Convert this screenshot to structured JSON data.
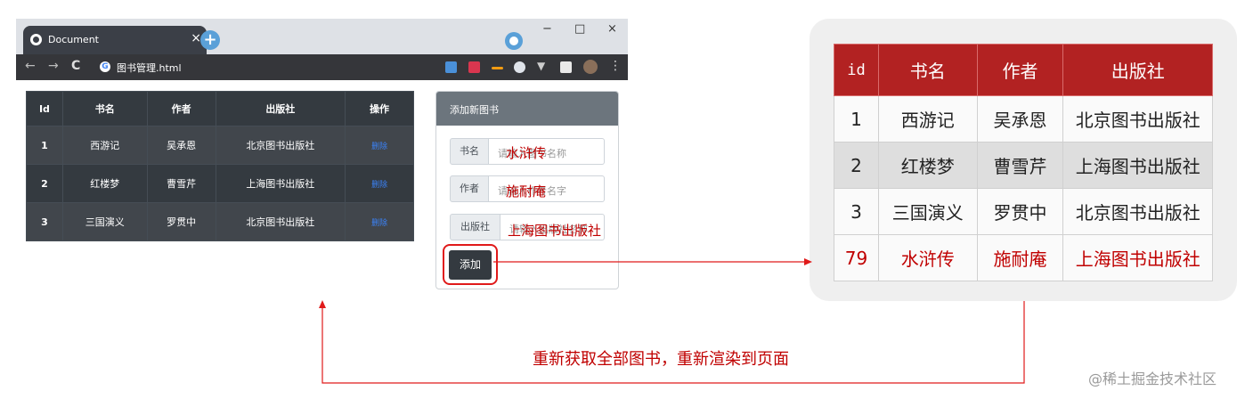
{
  "browser": {
    "tab_title": "Document",
    "tab_close": "×",
    "new_tab": "+",
    "url": "图书管理.html",
    "nav": {
      "back": "←",
      "forward": "→",
      "reload": "C"
    },
    "window": {
      "minimize": "−",
      "maximize": "□",
      "close": "×"
    },
    "menu": "⋮"
  },
  "book_table": {
    "headers": [
      "Id",
      "书名",
      "作者",
      "出版社",
      "操作"
    ],
    "rows": [
      {
        "id": "1",
        "name": "西游记",
        "author": "吴承恩",
        "publisher": "北京图书出版社",
        "action": "删除"
      },
      {
        "id": "2",
        "name": "红楼梦",
        "author": "曹雪芹",
        "publisher": "上海图书出版社",
        "action": "删除"
      },
      {
        "id": "3",
        "name": "三国演义",
        "author": "罗贯中",
        "publisher": "北京图书出版社",
        "action": "删除"
      }
    ]
  },
  "add_panel": {
    "title": "添加新图书",
    "fields": [
      {
        "label": "书名",
        "placeholder": "请输入图书名称",
        "typed": "水浒传"
      },
      {
        "label": "作者",
        "placeholder": "请输入作者名字",
        "typed": "施耐庵"
      },
      {
        "label": "出版社",
        "placeholder": "请输入出版社名称",
        "typed": "上海图书出版社"
      }
    ],
    "add_button": "添加"
  },
  "result_table": {
    "headers": [
      "id",
      "书名",
      "作者",
      "出版社"
    ],
    "rows": [
      {
        "id": "1",
        "name": "西游记",
        "author": "吴承恩",
        "publisher": "北京图书出版社"
      },
      {
        "id": "2",
        "name": "红楼梦",
        "author": "曹雪芹",
        "publisher": "上海图书出版社"
      },
      {
        "id": "3",
        "name": "三国演义",
        "author": "罗贯中",
        "publisher": "北京图书出版社"
      },
      {
        "id": "79",
        "name": "水浒传",
        "author": "施耐庵",
        "publisher": "上海图书出版社"
      }
    ]
  },
  "caption": "重新获取全部图书，重新渲染到页面",
  "watermark": "@稀土掘金技术社区",
  "colors": {
    "accent_red": "#c00000",
    "header_red": "#b22222",
    "dark_table": "#343a40",
    "arrow_red": "#e01a1a"
  }
}
